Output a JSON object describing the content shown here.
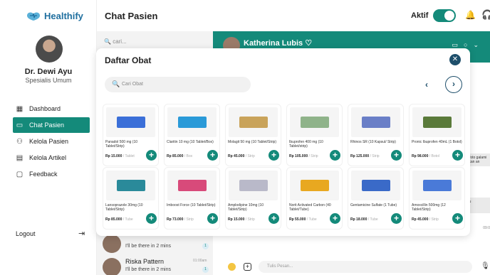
{
  "brand": {
    "name": "Healthify"
  },
  "profile": {
    "name": "Dr. Dewi Ayu",
    "role": "Spesialis Umum"
  },
  "nav": [
    {
      "label": "Dashboard",
      "icon": "grid-icon"
    },
    {
      "label": "Chat Pasien",
      "icon": "chat-icon",
      "active": true
    },
    {
      "label": "Kelola Pasien",
      "icon": "users-icon"
    },
    {
      "label": "Kelola Artikel",
      "icon": "article-icon"
    },
    {
      "label": "Feedback",
      "icon": "feedback-icon"
    }
  ],
  "logout": {
    "label": "Logout"
  },
  "header": {
    "title": "Chat Pasien",
    "status": "Aktif"
  },
  "chat_list": {
    "search_placeholder": "cari...",
    "items": [
      {
        "name": "",
        "message": "I'll be there in 2 mins",
        "time": "",
        "badge": "1"
      },
      {
        "name": "Riska Pattern",
        "message": "I'll be there in 2 mins",
        "time": "01:00am",
        "badge": "1"
      }
    ]
  },
  "chat": {
    "name": "Katherina Lubis",
    "bubbles": [
      "en foto galami saikan an",
      "uulu"
    ],
    "time": "09:0",
    "input_placeholder": "Tulis Pesan..."
  },
  "modal": {
    "title": "Daftar Obat",
    "search_placeholder": "Cari Obat",
    "medicines": [
      {
        "name": "Panadol 500 mg (10 Tablet/Strip)",
        "price": "Rp 15.000",
        "unit": "/ Tablet",
        "color": "#3b6fd8"
      },
      {
        "name": "Claritin 10 mg (10 Tablet/Box)",
        "price": "Rp 85.000",
        "unit": "/ Box",
        "color": "#2a9ad8"
      },
      {
        "name": "Molagit 50 mg (10 Tablet/Strip)",
        "price": "Rp 45.000",
        "unit": "/ Strip",
        "color": "#c9a35a"
      },
      {
        "name": "Ibuprofen 400 mg (10 Tablet/strip)",
        "price": "Rp 105.000",
        "unit": "/ Strip",
        "color": "#8fb38a"
      },
      {
        "name": "Rhinos SR (10 Kapsul/ Strip)",
        "price": "Rp 125.000",
        "unit": "/ Strip",
        "color": "#6a7fc7"
      },
      {
        "name": "Pronic Ibuprofen 40mL (1 Botol)",
        "price": "Rp 98.000",
        "unit": "/ Botol",
        "color": "#5a7a3a"
      },
      {
        "name": "Lansoprazole 30mg (10 Tablet/Strip)",
        "price": "Rp 85.000",
        "unit": "/ Tube",
        "color": "#2a8a9a"
      },
      {
        "name": "Imboost Force (10 Tablet/Strip)",
        "price": "Rp 73.000",
        "unit": "/ Strip",
        "color": "#d84a7a"
      },
      {
        "name": "Amplodipine 10mg (10 Tablet/Strip)",
        "price": "Rp 15.000",
        "unit": "/ Strip",
        "color": "#b9b9c9"
      },
      {
        "name": "Norit Activated Carbon (40 Tablet/Tube)",
        "price": "Rp 55.000",
        "unit": "/ Tube",
        "color": "#e8a820"
      },
      {
        "name": "Gentamicine Sulfate (1 Tube)",
        "price": "Rp 18.000",
        "unit": "/ Tube",
        "color": "#3a6ac8"
      },
      {
        "name": "Amoxcillin 500mg (12 Tablet/Strip)",
        "price": "Rp 45.000",
        "unit": "/ Strip",
        "color": "#4a7ad8"
      }
    ]
  },
  "colors": {
    "primary": "#148a7a",
    "accent": "#1e4f6b"
  }
}
